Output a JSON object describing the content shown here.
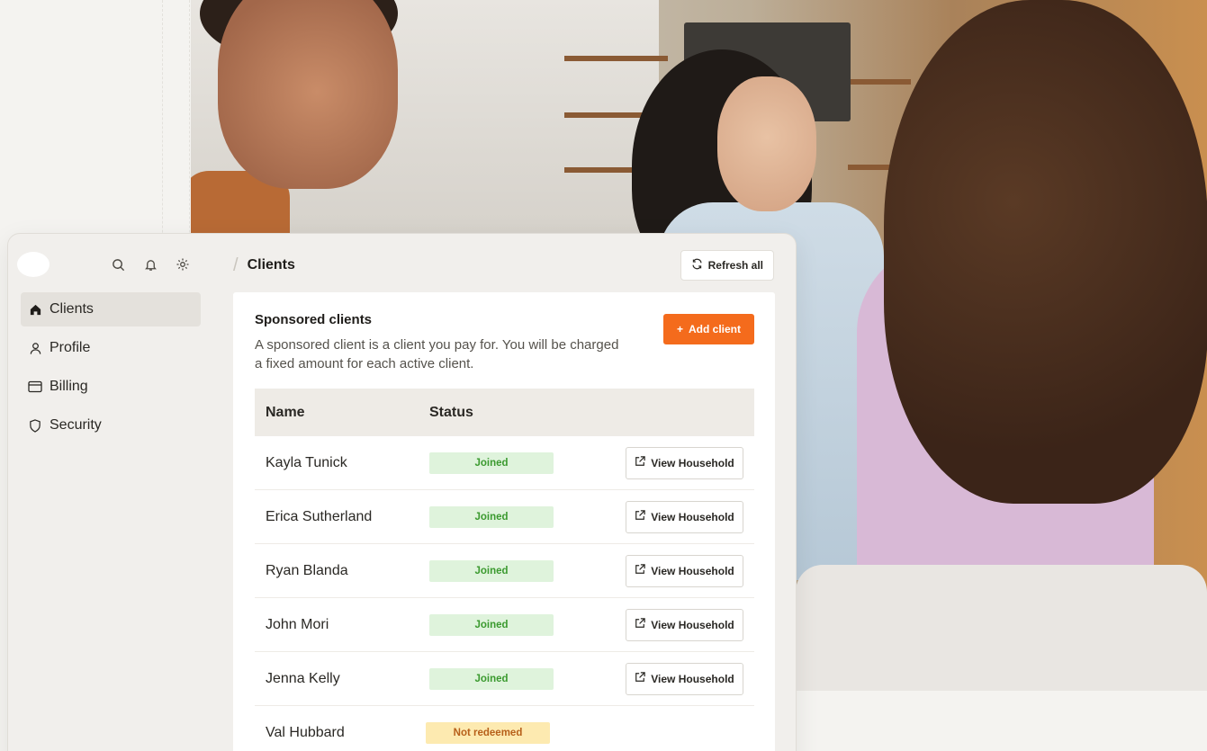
{
  "header": {
    "title": "Clients",
    "refresh_label": "Refresh all"
  },
  "top_icons": [
    "search-icon",
    "bell-icon",
    "gear-icon"
  ],
  "sidebar": {
    "items": [
      {
        "label": "Clients",
        "icon": "home-icon",
        "active": true
      },
      {
        "label": "Profile",
        "icon": "user-icon",
        "active": false
      },
      {
        "label": "Billing",
        "icon": "credit-card-icon",
        "active": false
      },
      {
        "label": "Security",
        "icon": "shield-icon",
        "active": false
      }
    ]
  },
  "section": {
    "title": "Sponsored clients",
    "description": "A sponsored client is a client you pay for. You will be charged a fixed amount for each active client.",
    "add_label": "Add client"
  },
  "table": {
    "columns": [
      "Name",
      "Status"
    ],
    "action_label": "View Household",
    "rows": [
      {
        "name": "Kayla Tunick",
        "status": "Joined"
      },
      {
        "name": "Erica Sutherland",
        "status": "Joined"
      },
      {
        "name": "Ryan Blanda",
        "status": "Joined"
      },
      {
        "name": "John Mori",
        "status": "Joined"
      },
      {
        "name": "Jenna Kelly",
        "status": "Joined"
      },
      {
        "name": "Val Hubbard",
        "status": "Not redeemed"
      }
    ]
  },
  "colors": {
    "accent": "#f46b1c",
    "joined_bg": "#dff3dc",
    "joined_text": "#3b9a2f",
    "pending_bg": "#fdeab0",
    "pending_text": "#b7601a"
  }
}
